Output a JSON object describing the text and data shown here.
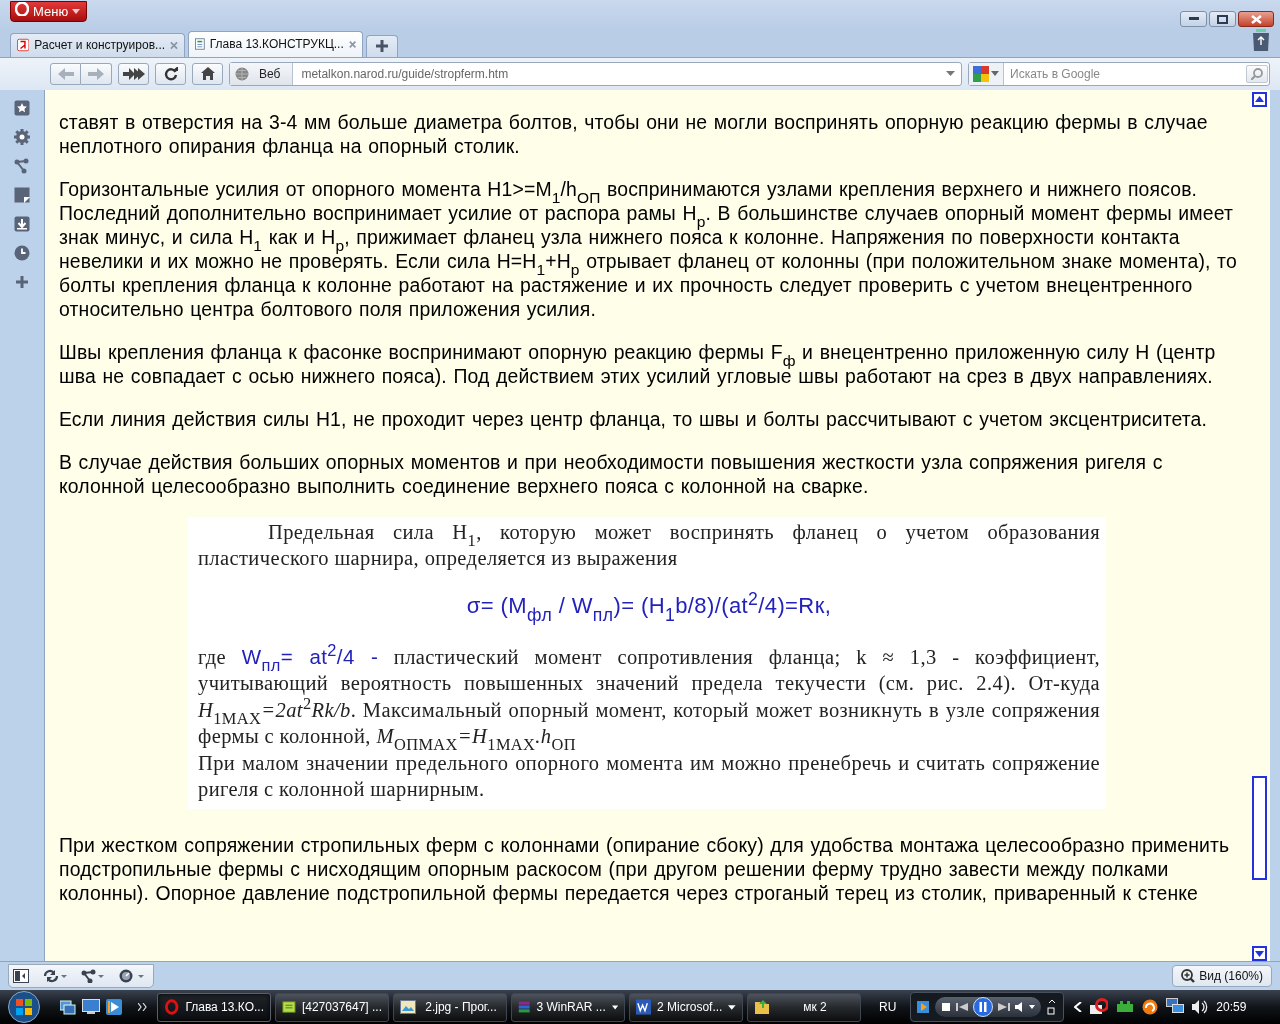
{
  "window": {
    "menu_label": "Меню"
  },
  "tabs": [
    {
      "label": "Расчет и конструиров...",
      "selected": false
    },
    {
      "label": "Глава 13.КОНСТРУКЦ...",
      "selected": true
    }
  ],
  "address_bar": {
    "scope_label": "Веб",
    "url": "metalkon.narod.ru/guide/stropferm.htm"
  },
  "search": {
    "placeholder": "Искать в Google"
  },
  "article": {
    "blocks": [
      {
        "kind": "paragraph",
        "text": "ставят в отверстия на 3-4 мм больше диаметра болтов, чтобы они не могли воспринять опорную реакцию фермы в случае неплотного опирания фланца на опорный столик."
      },
      {
        "kind": "paragraph",
        "text": "Горизонтальные усилия от опорного момента H1>=M$_{1}$/h$_{ОП}$ воспринимаются узлами крепления верхнего и нижнего поясов. Последний дополнительно воспринимает усилие от распора рамы H$_{р}$. В большинстве случаев опорный момент фермы имеет знак минус, и сила H$_{1}$ как и H$_{р}$, прижимает фланец узла нижнего пояса к колонне. Напряжения по поверхности контакта невелики и их можно не проверять. Если сила H=H$_{1}$+H$_{р}$ отрывает фланец от колонны (при положительном знаке момента), то болты крепления фланца к колонне работают на растяжение и их прочность следует проверить с учетом внецентренного относительно центра болтового поля приложения усилия."
      },
      {
        "kind": "paragraph",
        "text": "Швы крепления фланца к фасонке воспринимают опорную реакцию фермы F$_{ф}$ и внецентренно приложенную силу H (центр шва не совпадает с осью нижнего пояса). Под действием этих усилий угловые швы работают на срез в двух направлениях."
      },
      {
        "kind": "paragraph",
        "text": "Если линия действия силы H1, не проходит через центр фланца, то швы и болты рассчитывают с учетом эксцентриситета."
      },
      {
        "kind": "paragraph",
        "text": "В случае действия больших опорных моментов и при необходимости повышения жесткости узла сопряжения ригеля с колонной целесообразно выполнить соединение верхнего пояса с колонной на сварке."
      },
      {
        "kind": "scan",
        "paragraphs": [
          {
            "kind": "body",
            "indent": true,
            "segments": [
              {
                "kind": "text",
                "text": "Предельная сила H$_{1}$, которую может воспринять фланец о учетом образования пластического шарнира, определяется из выражения"
              }
            ]
          },
          {
            "kind": "equation",
            "indent": false,
            "segments": [
              {
                "kind": "formula",
                "text": "σ= (M$_{фл}$ / W$_{пл}$)= (H$_{1}$b/8)/(at$^{2}$/4)=Rк,"
              }
            ]
          },
          {
            "kind": "body",
            "indent": false,
            "segments": [
              {
                "kind": "text",
                "text": "где"
              },
              {
                "kind": "formula",
                "text": "W$_{пл}$= at$^{2}$/4 -"
              },
              {
                "kind": "text",
                "text": "пластический момент сопротивления фланца; k ≈ 1,3 - коэффициент, учитывающий вероятность повышенных значений предела текучести (см. рис. 2.4). От-куда *H*$_{1MAX}$*=2at*$^{2}$*Rk/b*. Максимальный опорный момент, который может возникнуть в узле сопряжения фермы с колонной, *M*$_{ОПMAX}$*=H*$_{1MAX}$*.h*$_{ОП}$"
              }
            ]
          },
          {
            "kind": "body",
            "indent": false,
            "segments": [
              {
                "kind": "text",
                "text": "При малом значении предельного опорного момента им можно пренебречь и считать сопряжение ригеля с колонной шарнирным."
              }
            ]
          }
        ]
      },
      {
        "kind": "paragraph",
        "text": "При жестком сопряжении стропильных ферм с колоннами (опирание сбоку) для удобства монтажа целесообразно применить подстропильные фермы с нисходящим опорным раскосом (при другом решении ферму трудно завести между полками колонны). Опорное давление подстропильной фермы передается через строганый терец из столик, приваренный к стенке"
      }
    ]
  },
  "status_bar": {
    "zoom_label": "Вид (160%)"
  },
  "taskbar": {
    "items": [
      {
        "label": "Глава 13.КО...",
        "selected": true,
        "kind": "opera"
      },
      {
        "label": "[427037647] ...",
        "selected": false,
        "kind": "chat"
      },
      {
        "label": "2.jpg - Прог...",
        "selected": false,
        "kind": "image"
      },
      {
        "label": "3 WinRAR ...",
        "selected": false,
        "kind": "archive"
      },
      {
        "label": "2 Microsof...",
        "selected": false,
        "kind": "word"
      },
      {
        "label": "мк 2",
        "selected": false,
        "kind": "folder"
      }
    ],
    "language": "RU",
    "clock": "20:59"
  }
}
